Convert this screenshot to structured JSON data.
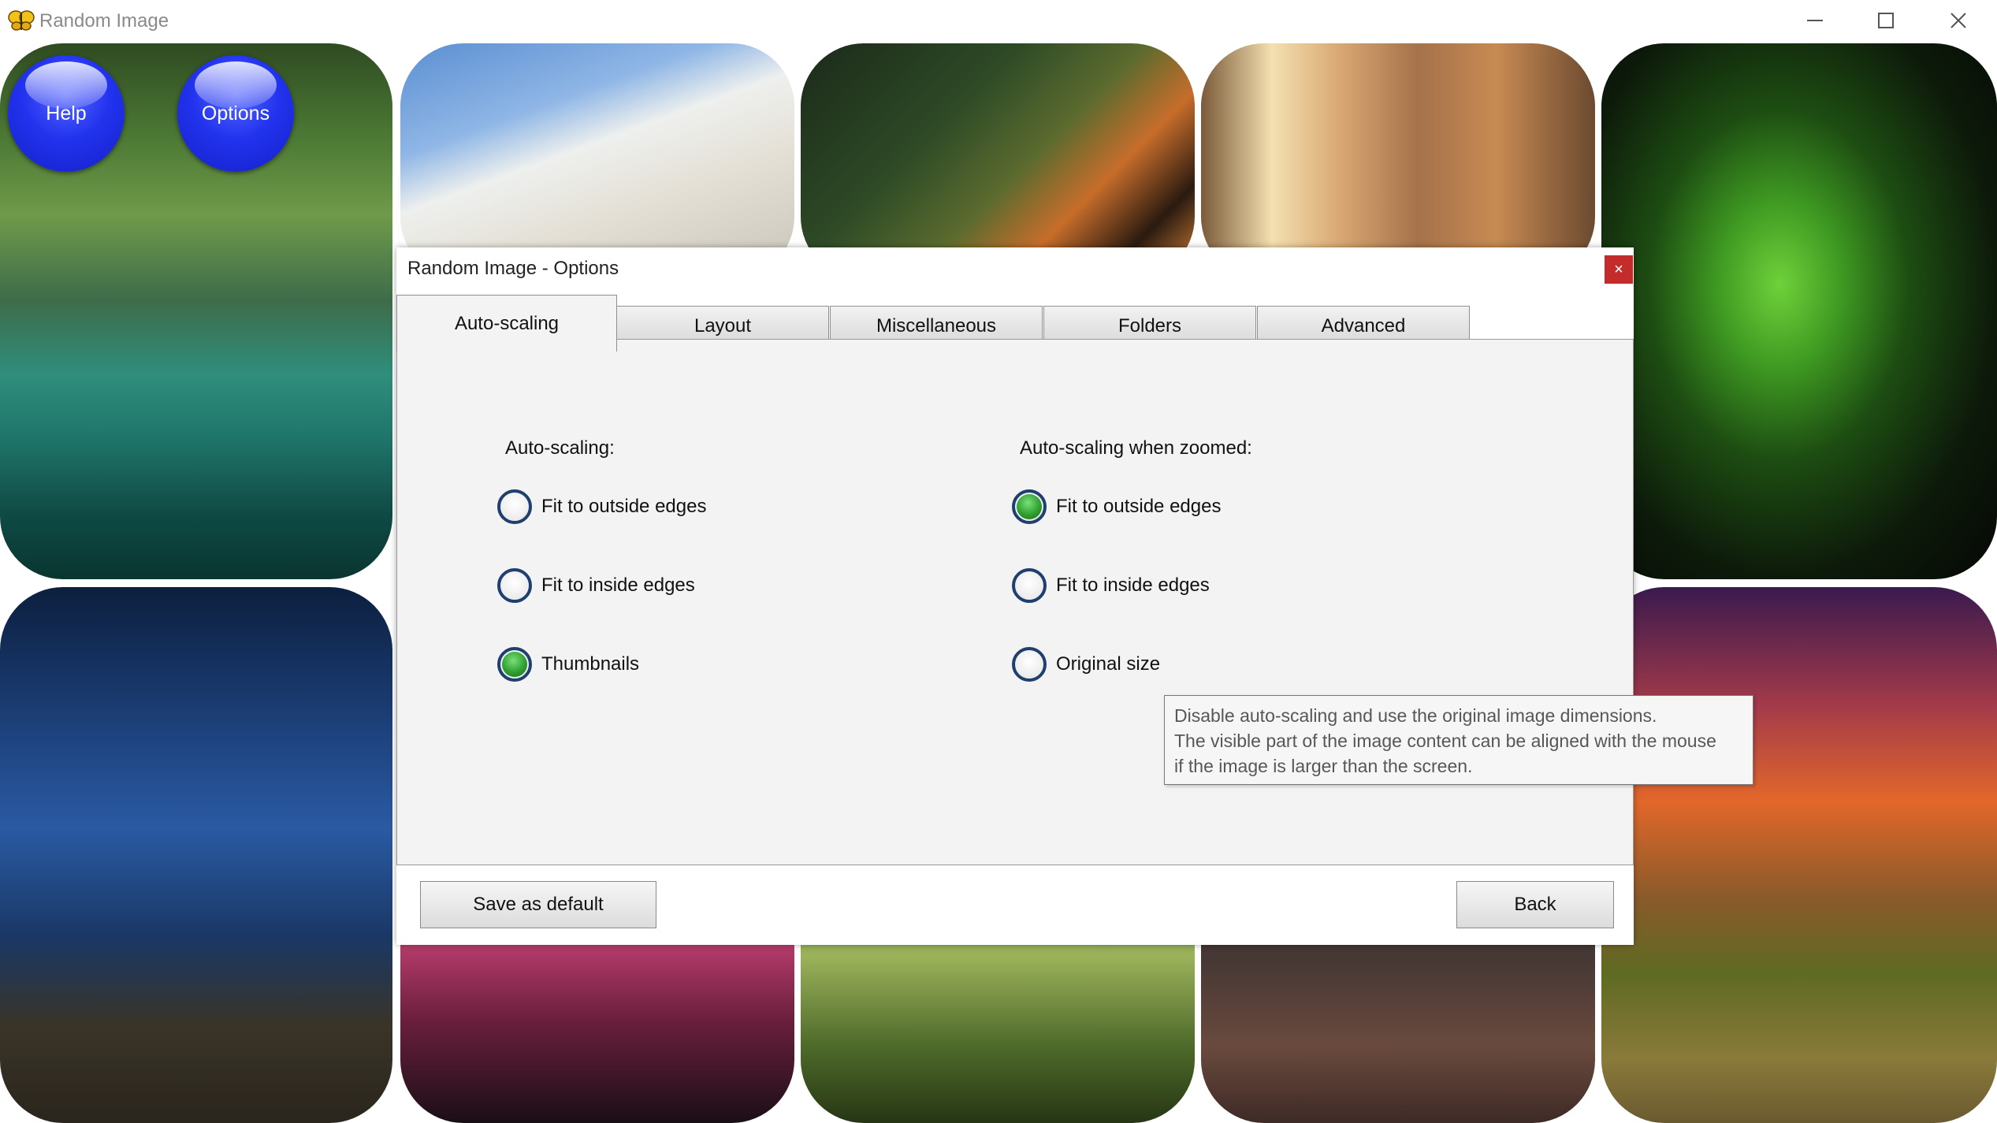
{
  "window": {
    "title": "Random Image",
    "icon": "butterfly-icon",
    "controls": [
      "minimize-icon",
      "maximize-icon",
      "close-icon"
    ]
  },
  "overlay_buttons": {
    "help": "Help",
    "options": "Options"
  },
  "dialog": {
    "title": "Random Image - Options",
    "close_label": "×",
    "tabs": [
      {
        "label": "Auto-scaling",
        "active": true
      },
      {
        "label": "Layout",
        "active": false
      },
      {
        "label": "Miscellaneous",
        "active": false
      },
      {
        "label": "Folders",
        "active": false
      },
      {
        "label": "Advanced",
        "active": false
      }
    ],
    "auto_scaling": {
      "label": "Auto-scaling:",
      "options": [
        {
          "label": "Fit to outside edges",
          "checked": false
        },
        {
          "label": "Fit to inside edges",
          "checked": false
        },
        {
          "label": "Thumbnails",
          "checked": true
        }
      ]
    },
    "auto_scaling_zoomed": {
      "label": "Auto-scaling when zoomed:",
      "options": [
        {
          "label": "Fit to outside edges",
          "checked": true
        },
        {
          "label": "Fit to inside edges",
          "checked": false
        },
        {
          "label": "Original size",
          "checked": false
        }
      ]
    },
    "buttons": {
      "save_default": "Save as default",
      "back": "Back"
    }
  },
  "tooltip": {
    "lines": [
      "Disable auto-scaling and use the original image dimensions.",
      "The visible part of the image content can be aligned with the mouse",
      "if the image is larger than the screen."
    ]
  },
  "colors": {
    "accent_blue": "#2233ee",
    "radio_border": "#1f3f6e",
    "radio_checked": "#2fa02f",
    "close_red": "#c42b2b"
  }
}
